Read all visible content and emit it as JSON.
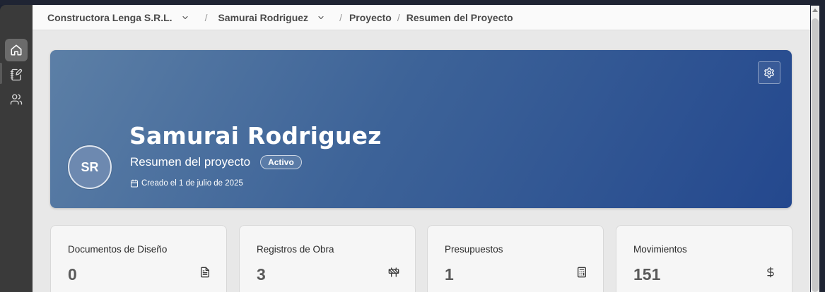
{
  "breadcrumb": {
    "company": "Constructora Lenga S.R.L.",
    "client": "Samurai Rodriguez",
    "section": "Proyecto",
    "page": "Resumen del Proyecto",
    "separator": "/"
  },
  "sidebar": {
    "items": [
      {
        "icon": "home-icon",
        "active": true
      },
      {
        "icon": "notebook-pen-icon",
        "active": false
      },
      {
        "icon": "users-icon",
        "active": false
      }
    ]
  },
  "hero": {
    "avatar_initials": "SR",
    "title": "Samurai Rodriguez",
    "subtitle": "Resumen del proyecto",
    "status": "Activo",
    "created": "Creado el 1 de julio de 2025",
    "gradient_start": "#5c7fa6",
    "gradient_end": "#24488e"
  },
  "stats": [
    {
      "label": "Documentos de Diseño",
      "value": "0",
      "icon": "file-text-icon"
    },
    {
      "label": "Registros de Obra",
      "value": "3",
      "icon": "construction-icon"
    },
    {
      "label": "Presupuestos",
      "value": "1",
      "icon": "calculator-icon"
    },
    {
      "label": "Movimientos",
      "value": "151",
      "icon": "dollar-icon"
    }
  ]
}
